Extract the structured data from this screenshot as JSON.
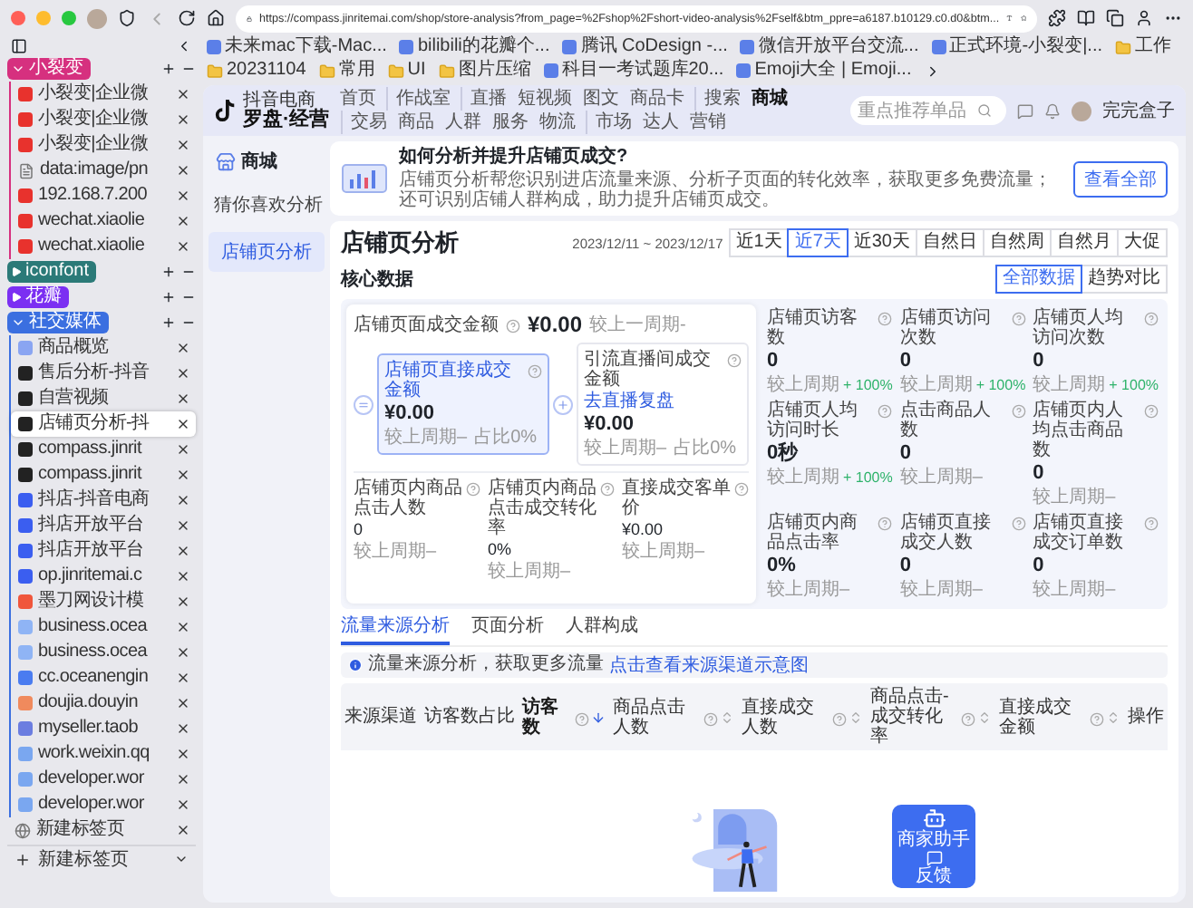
{
  "browser": {
    "url": "https://compass.jinritemai.com/shop/store-analysis?from_page=%2Fshop%2Fshort-video-analysis%2Fself&btm_ppre=a6187.b10129.c0.d0&btm...",
    "bookmarks": [
      {
        "label": "未来mac下载-Mac...",
        "kind": "site"
      },
      {
        "label": "bilibili的花瓣个...",
        "kind": "site"
      },
      {
        "label": "腾讯 CoDesign -...",
        "kind": "site"
      },
      {
        "label": "微信开放平台交流...",
        "kind": "site"
      },
      {
        "label": "正式环境-小裂变|...",
        "kind": "site"
      },
      {
        "label": "工作",
        "kind": "folder"
      },
      {
        "label": "20231104",
        "kind": "folder"
      },
      {
        "label": "常用",
        "kind": "folder"
      },
      {
        "label": "UI",
        "kind": "folder"
      },
      {
        "label": "图片压缩",
        "kind": "folder"
      },
      {
        "label": "科目一考试题库20...",
        "kind": "site"
      },
      {
        "label": "Emoji大全 | Emoji...",
        "kind": "site"
      }
    ]
  },
  "sidebar": {
    "groups": [
      {
        "name": "小裂变",
        "color": "#d6307f",
        "expanded": true,
        "tabs": [
          {
            "title": "小裂变|企业微",
            "kind": "xiaoliebian",
            "selected": false
          },
          {
            "title": "小裂变|企业微",
            "kind": "xiaoliebian",
            "selected": false
          },
          {
            "title": "小裂变|企业微",
            "kind": "xiaoliebian",
            "selected": false
          },
          {
            "title": "data:image/pn",
            "kind": "file",
            "selected": false
          },
          {
            "title": "192.168.7.200",
            "kind": "xiaoliebian",
            "selected": false
          },
          {
            "title": "wechat.xiaolie",
            "kind": "xiaoliebian",
            "selected": false
          },
          {
            "title": "wechat.xiaolie",
            "kind": "xiaoliebian",
            "selected": false
          }
        ]
      },
      {
        "name": "iconfont",
        "color": "#2b7a78",
        "expanded": false
      },
      {
        "name": "花瓣",
        "color": "#7b2ff2",
        "expanded": false
      },
      {
        "name": "社交媒体",
        "color": "#3b6fe0",
        "expanded": true,
        "tabs": [
          {
            "title": "商品概览",
            "kind": "compass",
            "selected": false
          },
          {
            "title": "售后分析-抖音",
            "kind": "douyin",
            "selected": false
          },
          {
            "title": "自营视频",
            "kind": "douyin",
            "selected": false
          },
          {
            "title": "店铺页分析-抖",
            "kind": "douyin",
            "selected": true
          },
          {
            "title": "compass.jinrit",
            "kind": "douyin",
            "selected": false
          },
          {
            "title": "compass.jinrit",
            "kind": "douyin",
            "selected": false
          },
          {
            "title": "抖店-抖音电商",
            "kind": "doudian",
            "selected": false
          },
          {
            "title": "抖店开放平台",
            "kind": "doudian",
            "selected": false
          },
          {
            "title": "抖店开放平台",
            "kind": "doudian",
            "selected": false
          },
          {
            "title": "op.jinritemai.c",
            "kind": "doudian",
            "selected": false
          },
          {
            "title": "墨刀网设计模",
            "kind": "modao",
            "selected": false
          },
          {
            "title": "business.ocea",
            "kind": "ocean",
            "selected": false
          },
          {
            "title": "business.ocea",
            "kind": "ocean",
            "selected": false
          },
          {
            "title": "cc.oceanengin",
            "kind": "cc",
            "selected": false
          },
          {
            "title": "doujia.douyin",
            "kind": "fire",
            "selected": false
          },
          {
            "title": "myseller.taob",
            "kind": "taobao",
            "selected": false
          },
          {
            "title": "work.weixin.qq",
            "kind": "wecom",
            "selected": false
          },
          {
            "title": "developer.wor",
            "kind": "wecom",
            "selected": false
          },
          {
            "title": "developer.wor",
            "kind": "wecom",
            "selected": false
          }
        ]
      }
    ],
    "loose_tabs": [
      {
        "title": "新建标签页",
        "kind": "newtab",
        "selected": false
      }
    ],
    "new_tab": "新建标签页"
  },
  "nav": {
    "logo_top": "抖音电商",
    "logo": "罗盘·经营",
    "groups": [
      [
        {
          "label": "首页",
          "selected": false
        }
      ],
      [
        {
          "label": "作战室",
          "selected": false
        }
      ],
      [
        {
          "label": "直播",
          "selected": false
        },
        {
          "label": "短视频",
          "selected": false
        },
        {
          "label": "图文",
          "selected": false
        },
        {
          "label": "商品卡",
          "selected": false
        }
      ],
      [
        {
          "label": "搜索",
          "selected": false
        },
        {
          "label": "商城",
          "selected": true
        }
      ],
      [
        {
          "label": "交易",
          "selected": false
        },
        {
          "label": "商品",
          "selected": false
        },
        {
          "label": "人群",
          "selected": false
        },
        {
          "label": "服务",
          "selected": false
        },
        {
          "label": "物流",
          "selected": false
        }
      ],
      [
        {
          "label": "市场",
          "selected": false
        },
        {
          "label": "达人",
          "selected": false
        },
        {
          "label": "营销",
          "selected": false
        }
      ]
    ],
    "search": {
      "placeholder": "重点推荐单品"
    },
    "user": "完完盒子"
  },
  "menu": {
    "title": "商城",
    "items": [
      {
        "label": "猜你喜欢分析",
        "selected": false
      },
      {
        "label": "店铺页分析",
        "selected": true
      }
    ]
  },
  "banner": {
    "title": "如何分析并提升店铺页成交?",
    "text": "店铺页分析帮您识别进店流量来源、分析子页面的转化效率，获取更多免费流量；还可识别店铺人群构成，助力提升店铺页成交。",
    "button": "查看全部"
  },
  "analysis": {
    "title": "店铺页分析",
    "date_range": "2023/12/11 ~ 2023/12/17",
    "ranges": [
      {
        "label": "近1天",
        "selected": false
      },
      {
        "label": "近7天",
        "selected": true
      },
      {
        "label": "近30天",
        "selected": false
      },
      {
        "label": "自然日",
        "selected": false
      },
      {
        "label": "自然周",
        "selected": false
      },
      {
        "label": "自然月",
        "selected": false
      },
      {
        "label": "大促",
        "selected": false
      }
    ],
    "section": "核心数据",
    "views": [
      {
        "label": "全部数据",
        "selected": true
      },
      {
        "label": "趋势对比",
        "selected": false
      }
    ],
    "total": {
      "label": "店铺页面成交金额",
      "value": "¥0.00",
      "compare": "较上一周期-"
    },
    "parts": [
      {
        "label": "店铺页直接成交金额",
        "value": "¥0.00",
        "compare": "较上周期–",
        "share": "占比0%",
        "selected": true
      },
      {
        "label": "引流直播间成交金额",
        "link": "去直播复盘",
        "value": "¥0.00",
        "compare": "较上周期–",
        "share": "占比0%",
        "selected": false
      }
    ],
    "sub_metrics": [
      {
        "label": "店铺页内商品点击人数",
        "value": "0",
        "compare": "较上周期–"
      },
      {
        "label": "店铺页内商品点击成交转化率",
        "value": "0%",
        "compare": "较上周期–"
      },
      {
        "label": "直接成交客单价",
        "value": "¥0.00",
        "compare": "较上周期–"
      }
    ],
    "metrics": [
      {
        "label": "店铺页访客数",
        "value": "0",
        "compare": "较上周期",
        "change": "+ 100%"
      },
      {
        "label": "店铺页访问次数",
        "value": "0",
        "compare": "较上周期",
        "change": "+ 100%"
      },
      {
        "label": "店铺页人均访问次数",
        "value": "0",
        "compare": "较上周期",
        "change": "+ 100%"
      },
      {
        "label": "店铺页人均访问时长",
        "value": "0秒",
        "compare": "较上周期",
        "change": "+ 100%"
      },
      {
        "label": "点击商品人数",
        "value": "0",
        "compare": "较上周期–"
      },
      {
        "label": "店铺页内人均点击商品数",
        "value": "0",
        "compare": "较上周期–"
      },
      {
        "label": "店铺页内商品点击率",
        "value": "0%",
        "compare": "较上周期–"
      },
      {
        "label": "店铺页直接成交人数",
        "value": "0",
        "compare": "较上周期–"
      },
      {
        "label": "店铺页直接成交订单数",
        "value": "0",
        "compare": "较上周期–"
      }
    ]
  },
  "tabs": [
    {
      "label": "流量来源分析",
      "selected": true
    },
    {
      "label": "页面分析",
      "selected": false
    },
    {
      "label": "人群构成",
      "selected": false
    }
  ],
  "notice": {
    "text": "流量来源分析，获取更多流量",
    "link": "点击查看来源渠道示意图"
  },
  "table": {
    "columns": [
      {
        "label": "来源渠道",
        "help": false,
        "sortable": false,
        "sorted": false
      },
      {
        "label": "访客数占比",
        "help": false,
        "sortable": false,
        "sorted": false
      },
      {
        "label": "访客数",
        "help": true,
        "sortable": true,
        "sorted": true
      },
      {
        "label": "商品点击人数",
        "help": true,
        "sortable": true,
        "sorted": false
      },
      {
        "label": "直接成交人数",
        "help": true,
        "sortable": true,
        "sorted": false
      },
      {
        "label": "商品点击-成交转化率",
        "help": true,
        "sortable": true,
        "sorted": false
      },
      {
        "label": "直接成交金额",
        "help": true,
        "sortable": true,
        "sorted": false
      },
      {
        "label": "操作",
        "help": false,
        "sortable": false,
        "sorted": false
      }
    ]
  },
  "assistant": {
    "title": "商家助手",
    "feedback": "反馈"
  }
}
